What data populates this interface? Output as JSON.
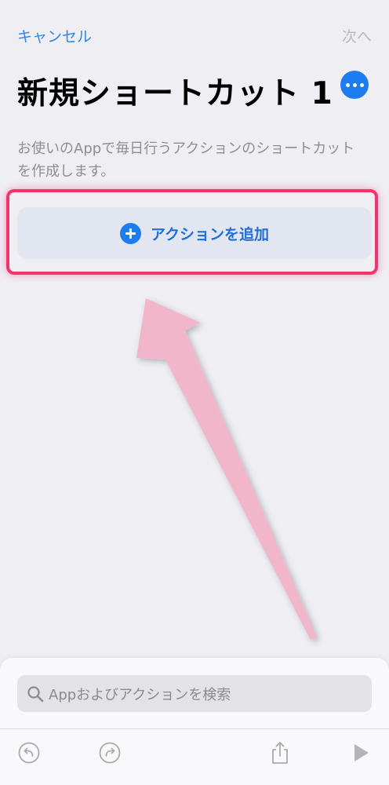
{
  "nav": {
    "cancel_label": "キャンセル",
    "next_label": "次へ"
  },
  "shortcut": {
    "title": "新規ショートカット 1"
  },
  "description": "お使いのAppで毎日行うアクションのショートカットを作成します。",
  "add_action": {
    "label": "アクションを追加",
    "icon": "plus-circle-icon"
  },
  "search": {
    "placeholder": "Appおよびアクションを検索"
  },
  "toolbar": {
    "icons": [
      "undo-icon",
      "redo-icon",
      "share-icon",
      "play-icon"
    ]
  },
  "colors": {
    "accent": "#1e7cf2",
    "highlight": "#f2336e",
    "background": "#efeef3"
  }
}
